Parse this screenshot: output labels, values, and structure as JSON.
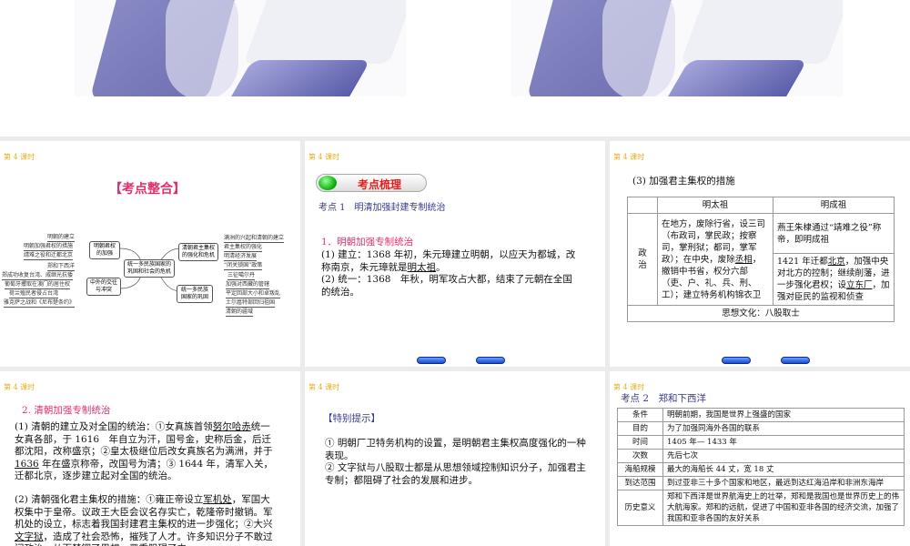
{
  "lesson_label": "第 4 课时",
  "slide1": {
    "title": "【考点整合】",
    "center": "统一多民族国家的巩固和社会的危机",
    "nodes": [
      {
        "label": "明朝君权的加强",
        "items": [
          "明朝的建立",
          "明朝加强君权的措施",
          "靖难之役和迁都北京"
        ]
      },
      {
        "label": "中外的交往与冲突",
        "items": [
          "郑和下西洋",
          "郑成功收复台湾、戚继光抗倭",
          "葡萄牙攫取在澳门的居住权",
          "荷兰殖民者侵占台湾",
          "雅克萨之战和《尼布楚条约》"
        ]
      },
      {
        "label": "清朝君主集权的强化和危机",
        "items": [
          "满洲的兴起和清朝的建立",
          "君主集权的强化",
          "明清经济发展",
          "“闭关锁国”政策"
        ]
      },
      {
        "label": "统一多民族国家的巩固",
        "items": [
          "三征噶尔丹",
          "加强对西藏的管辖",
          "平定回部大小和卓叛乱",
          "土尔扈特部回归祖国",
          "清朝的疆域"
        ]
      }
    ]
  },
  "slide2": {
    "badge": "考点梳理",
    "subtitle": "考点 1　明清加强封建专制统治",
    "heading": "1．明朝加强专制统治",
    "p1a": "(1) 建立：1368 年初，朱元璋建立明朝，以应天为都城，改称南京，朱元璋就是",
    "p1u": "明太祖",
    "p1b": "。",
    "p2": "(2) 统一：1368　年秋，明军攻占大都，结束了元朝在全国的统治。"
  },
  "slide3": {
    "heading": "(3) 加强君主集权的措施",
    "col1": "明太祖",
    "col2": "明成祖",
    "row_label": "政治",
    "taizu_a": "在地方，废除行省，设三司（布政司，掌民政；按察司，掌刑狱；都司，掌军政）；在中央，废除",
    "taizu_u": "丞相",
    "taizu_b": "，撤销中书省，权分六部（吏、户、礼、兵、刑、工）；建立特务机构锦衣卫",
    "chengzu1": "燕王朱棣通过“靖难之役”称帝，即明成祖",
    "chengzu2a": "1421 年迁都",
    "chengzu2u1": "北京",
    "chengzu2b": "，加强中央对北方的控制；继续削藩，进一步强化君权；设",
    "chengzu2u2": "立东厂",
    "chengzu2c": "，加强对臣民的监视和侦查",
    "footer": "思想文化：八股取士"
  },
  "slide4": {
    "heading": "2. 清朝加强专制统治",
    "p1a": "(1) 清朝的建立及对全国的统治：①女真族首领",
    "p1u1": "努尔哈赤",
    "p1b": "统一女真各部，于 1616　年自立为汗，国号金，史称后金，后迁都沈阳，改称盛京；②皇太极继位后改女真族名为满洲，并于 ",
    "p1u2": "1636",
    "p1c": " 年在盛京称帝，改国号为清；③ 1644 年，清军入关，迁都北京，逐步建立起对全国的统治。",
    "p2a": "(2) 清朝强化君主集权的措施：①雍正帝设立",
    "p2u1": "军机处",
    "p2b": "，军国大权集中于皇帝。议政王大臣会议名存实亡，乾隆帝时撤销。军机处的设立，标志着我国封建君主集权的进一步强化；②大兴",
    "p2u2": "文字狱",
    "p2c": "，造成了社会恐怖，摧残了人才。许多知识分子不敢过问政治，从而禁锢了思想，严重阻碍了中"
  },
  "slide5": {
    "heading": "【特别提示】",
    "p1": "① 明朝厂卫特务机构的设置，是明朝君主集权高度强化的一种表现。",
    "p2": "② 文字狱与八股取士都是从思想领域控制知识分子，加强君主专制；都阻碍了社会的发展和进步。"
  },
  "slide6": {
    "heading": "考点 2　郑和下西洋",
    "rows": [
      {
        "k": "条件",
        "v": "明朝前期，我国是世界上强盛的国家"
      },
      {
        "k": "目的",
        "v": "为了加强同海外各国的联系"
      },
      {
        "k": "时间",
        "v": "1405 年— 1433 年"
      },
      {
        "k": "次数",
        "v": "先后七次"
      },
      {
        "k": "海船规模",
        "v": "最大的海船长 44 丈，宽 18 丈"
      },
      {
        "k": "到达范围",
        "v": "到过亚非三十多个国家和地区，最远到达红海沿岸和非洲东海岸"
      },
      {
        "k": "历史意义",
        "v": "郑和下西洋是世界航海史上的壮举，郑和是我国也是世界历史上的伟大航海家。郑和的远航，促进了中国和亚非各国的经济交流，加强了我国和亚非各国的友好关系"
      }
    ]
  }
}
